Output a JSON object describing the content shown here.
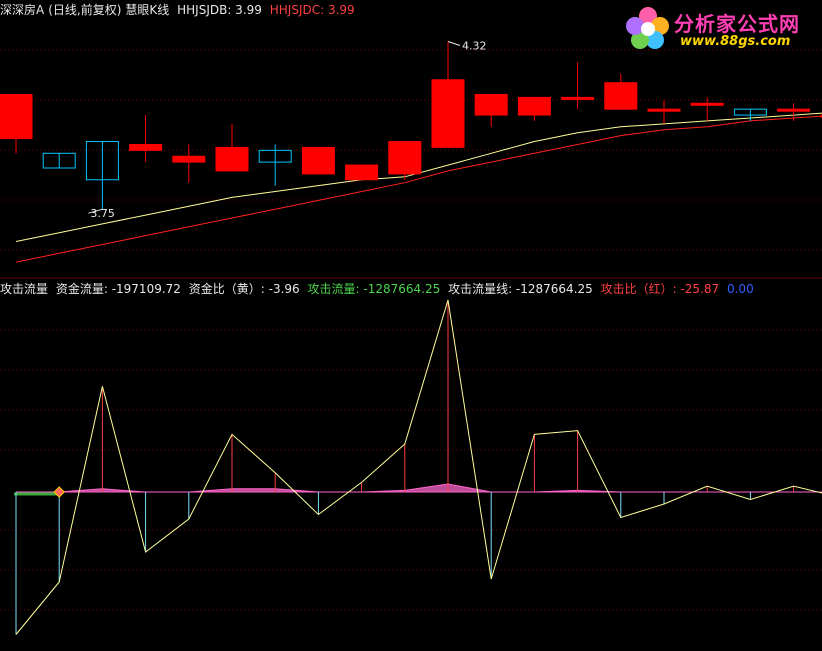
{
  "top_panel": {
    "title": "深深房A",
    "period": "(日线,前复权)",
    "indicator": "慧眼K线",
    "hhjsjdb_label": "HHJSJDB: 3.99",
    "hhjsjdc_label": "HHJSJDC: 3.99",
    "high_marker": "4.32",
    "low_marker": "3.75"
  },
  "bottom_panel": {
    "name": "攻击流量",
    "fund_flow": "资金流量: -197109.72",
    "fund_ratio": "资金比（黄）: -3.96",
    "attack_flow": "攻击流量: -1287664.25",
    "attack_flow_line": "攻击流量线: -1287664.25",
    "attack_ratio": "攻击比（红）: -25.87",
    "extra_value": "0.00"
  },
  "logo": {
    "name": "分析家公式网",
    "url": "www.88gs.com"
  },
  "colors": {
    "up": "#ff0000",
    "down": "#00c8ff",
    "ma_short": "#ffff99",
    "ma_long": "#ff2020",
    "flow_line": "#ffff99",
    "pink": "#ff66cc"
  },
  "chart_data": [
    {
      "type": "candlestick",
      "ylim": [
        3.55,
        4.4
      ],
      "candles": [
        {
          "open": 3.99,
          "close": 4.14,
          "high": 4.14,
          "low": 3.94
        },
        {
          "open": 3.94,
          "close": 3.89,
          "high": 3.94,
          "low": 3.89
        },
        {
          "open": 3.98,
          "close": 3.85,
          "high": 3.98,
          "low": 3.75
        },
        {
          "open": 3.95,
          "close": 3.97,
          "high": 4.07,
          "low": 3.91
        },
        {
          "open": 3.91,
          "close": 3.93,
          "high": 3.97,
          "low": 3.84
        },
        {
          "open": 3.88,
          "close": 3.96,
          "high": 4.04,
          "low": 3.88
        },
        {
          "open": 3.95,
          "close": 3.91,
          "high": 3.97,
          "low": 3.83
        },
        {
          "open": 3.87,
          "close": 3.96,
          "high": 3.96,
          "low": 3.87
        },
        {
          "open": 3.85,
          "close": 3.9,
          "high": 3.9,
          "low": 3.85
        },
        {
          "open": 3.87,
          "close": 3.98,
          "high": 3.98,
          "low": 3.85
        },
        {
          "open": 3.96,
          "close": 4.19,
          "high": 4.32,
          "low": 3.96
        },
        {
          "open": 4.07,
          "close": 4.14,
          "high": 4.14,
          "low": 4.03
        },
        {
          "open": 4.07,
          "close": 4.13,
          "high": 4.13,
          "low": 4.05
        },
        {
          "open": 4.13,
          "close": 4.13,
          "high": 4.25,
          "low": 4.09
        },
        {
          "open": 4.09,
          "close": 4.18,
          "high": 4.21,
          "low": 4.09
        },
        {
          "open": 4.09,
          "close": 4.09,
          "high": 4.12,
          "low": 4.04
        },
        {
          "open": 4.11,
          "close": 4.11,
          "high": 4.13,
          "low": 4.05
        },
        {
          "open": 4.09,
          "close": 4.07,
          "high": 4.09,
          "low": 4.05
        },
        {
          "open": 4.09,
          "close": 4.09,
          "high": 4.11,
          "low": 4.05
        },
        {
          "open": 4.07,
          "close": 4.07,
          "high": 4.07,
          "low": 4.07
        }
      ],
      "ma_short": [
        3.64,
        3.67,
        3.7,
        3.73,
        3.76,
        3.79,
        3.81,
        3.83,
        3.85,
        3.86,
        3.9,
        3.94,
        3.98,
        4.01,
        4.03,
        4.04,
        4.05,
        4.06,
        4.07,
        4.08
      ],
      "ma_long": [
        3.57,
        3.6,
        3.63,
        3.66,
        3.69,
        3.72,
        3.75,
        3.78,
        3.81,
        3.84,
        3.88,
        3.91,
        3.94,
        3.97,
        4.0,
        4.02,
        4.03,
        4.05,
        4.06,
        4.07
      ]
    },
    {
      "type": "line",
      "ylim": [
        -100,
        100
      ],
      "flow_line": [
        -95,
        -60,
        55,
        -40,
        -18,
        30,
        10,
        -15,
        5,
        25,
        100,
        -58,
        30,
        32,
        -17,
        -8,
        3,
        -5,
        3,
        -3
      ],
      "fund_ratio": [
        0,
        0,
        2,
        0,
        0,
        2,
        2,
        0,
        0,
        1,
        5,
        0,
        0,
        1,
        0,
        0,
        0,
        0,
        0,
        0
      ]
    }
  ]
}
